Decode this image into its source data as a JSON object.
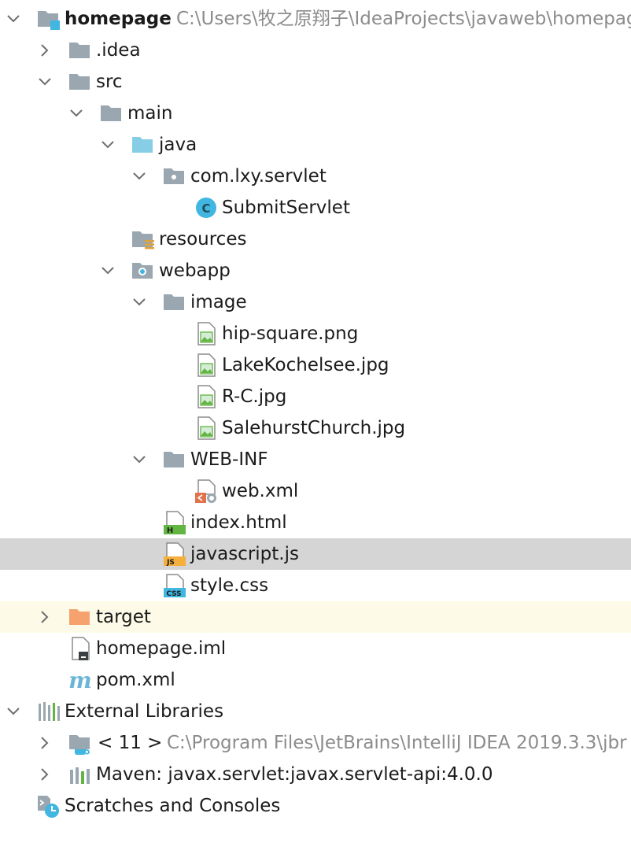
{
  "tree": {
    "project": {
      "name": "homepage",
      "path": "C:\\Users\\牧之原翔子\\IdeaProjects\\javaweb\\homepage"
    },
    "idea": ".idea",
    "src": "src",
    "main": "main",
    "java": "java",
    "package": "com.lxy.servlet",
    "servlet_class": "SubmitServlet",
    "resources": "resources",
    "webapp": "webapp",
    "image": "image",
    "images": [
      "hip-square.png",
      "LakeKochelsee.jpg",
      "R-C.jpg",
      "SalehurstChurch.jpg"
    ],
    "webinf": "WEB-INF",
    "web_xml": "web.xml",
    "index_html": "index.html",
    "javascript_js": "javascript.js",
    "style_css": "style.css",
    "target": "target",
    "homepage_iml": "homepage.iml",
    "pom_xml": "pom.xml"
  },
  "external_libraries": {
    "label": "External Libraries",
    "jdk_label": "< 11 >",
    "jdk_path": "C:\\Program Files\\JetBrains\\IntelliJ IDEA 2019.3.3\\jbr",
    "maven": "Maven: javax.servlet:javax.servlet-api:4.0.0"
  },
  "scratches": "Scratches and Consoles",
  "icons": {
    "folder": "folder-icon",
    "source-folder": "source-root-icon",
    "package": "package-icon",
    "class": "class-icon",
    "resources": "resources-folder-icon",
    "web": "web-folder-icon",
    "image-file": "image-file-icon",
    "xml": "xml-file-icon",
    "html": "html-file-icon",
    "js": "js-file-icon",
    "css": "css-file-icon",
    "excluded": "excluded-folder-icon",
    "iml": "iml-file-icon",
    "maven": "maven-icon",
    "library": "library-icon",
    "jdk": "jdk-icon",
    "scratches": "scratches-icon"
  },
  "colors": {
    "selection": "#d5d5d5",
    "highlight": "#fdfbe7",
    "folder": "#9aa7b0",
    "source_folder": "#87cde6",
    "excluded_folder": "#f5a26f",
    "class": "#40b6e0"
  }
}
